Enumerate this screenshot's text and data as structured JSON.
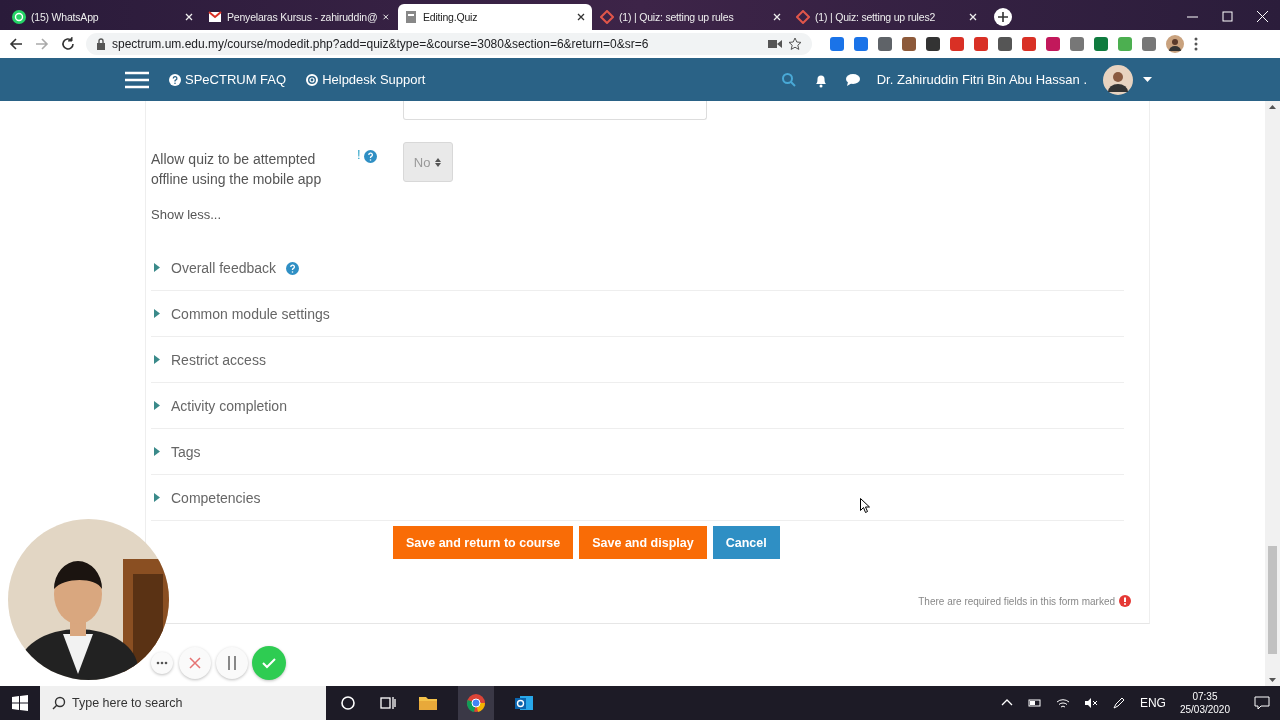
{
  "browser": {
    "tabs": [
      {
        "title": "(15) WhatsApp",
        "kind": "whatsapp",
        "selected": false
      },
      {
        "title": "Penyelaras Kursus - zahiruddin@",
        "kind": "mail",
        "selected": false
      },
      {
        "title": "Editing.Quiz",
        "kind": "page",
        "selected": true
      },
      {
        "title": "(1) | Quiz: setting up rules",
        "kind": "site",
        "selected": false
      },
      {
        "title": "(1) | Quiz: setting up rules2",
        "kind": "site",
        "selected": false
      }
    ],
    "url": "spectrum.um.edu.my/course/modedit.php?add=quiz&type=&course=3080&section=6&return=0&sr=6"
  },
  "navbar": {
    "links": [
      {
        "label": "SPeCTRUM FAQ",
        "kind": "help"
      },
      {
        "label": "Helpdesk Support",
        "kind": "lifebuoy"
      }
    ],
    "user_name": "Dr. Zahiruddin Fitri Bin Abu Hassan ."
  },
  "form": {
    "offline_field": {
      "label": "Allow quiz to be attempted offline using the mobile app",
      "flag": "!",
      "value": "No",
      "disabled": true
    },
    "show_less": "Show less...",
    "sections": [
      {
        "title": "Overall feedback",
        "has_help": true
      },
      {
        "title": "Common module settings",
        "has_help": false
      },
      {
        "title": "Restrict access",
        "has_help": false
      },
      {
        "title": "Activity completion",
        "has_help": false
      },
      {
        "title": "Tags",
        "has_help": false
      },
      {
        "title": "Competencies",
        "has_help": false
      }
    ],
    "buttons": [
      {
        "label": "Save and return to course",
        "kind": "primary"
      },
      {
        "label": "Save and display",
        "kind": "primary"
      },
      {
        "label": "Cancel",
        "kind": "secondary"
      }
    ],
    "required_note": "There are required fields in this form marked"
  },
  "taskbar": {
    "search_placeholder": "Type here to search",
    "language": "ENG",
    "time": "07:35",
    "date": "25/03/2020"
  }
}
